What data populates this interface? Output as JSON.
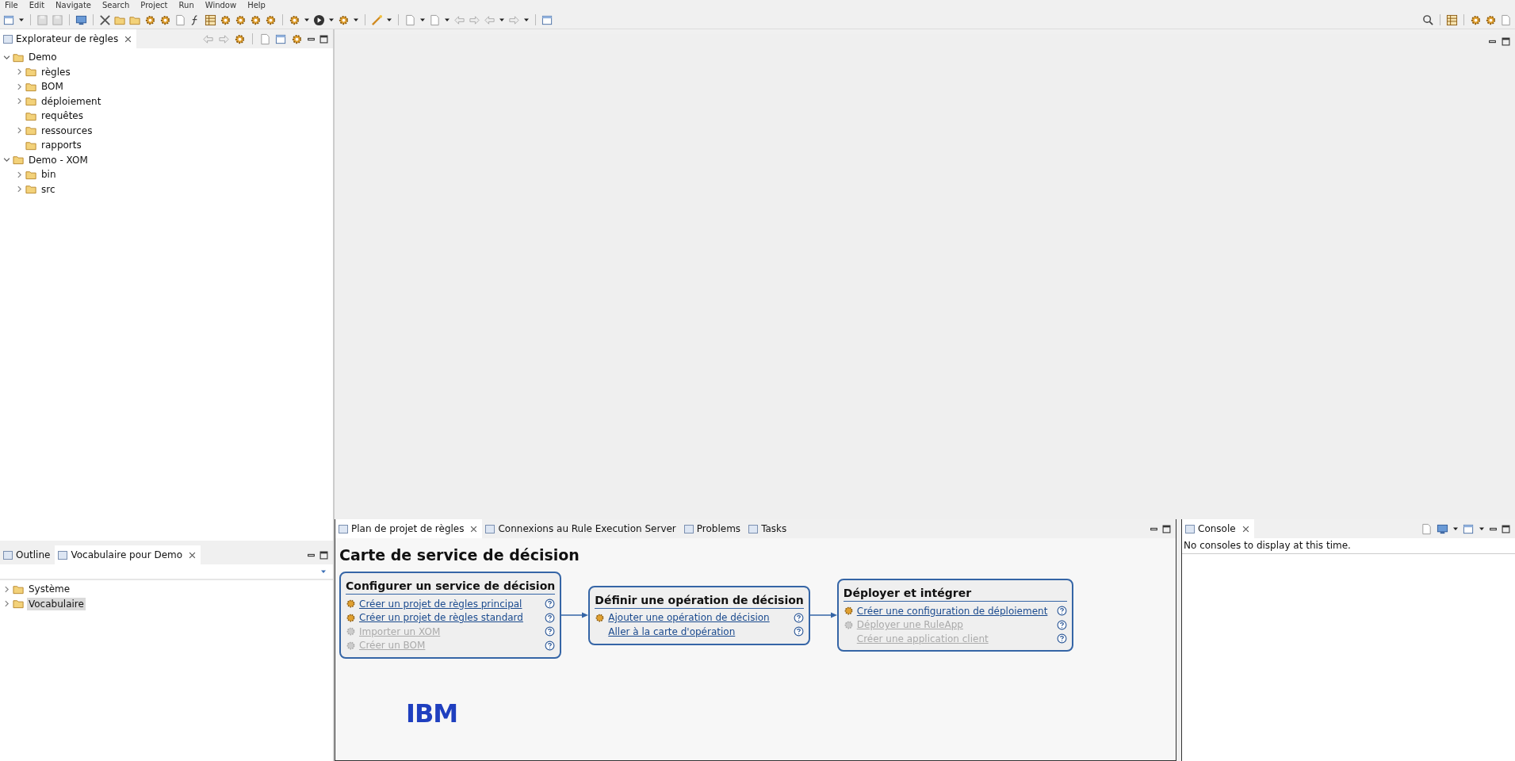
{
  "menu": [
    "File",
    "Edit",
    "Navigate",
    "Search",
    "Project",
    "Run",
    "Window",
    "Help"
  ],
  "explorer": {
    "tabs": [
      {
        "label": "Explorateur de règles",
        "selected": true
      }
    ],
    "tree": [
      {
        "label": "Demo",
        "kind": "expanded",
        "selected": false,
        "children": [
          {
            "label": "règles",
            "kind": "collapsed",
            "selected": false
          },
          {
            "label": "BOM",
            "kind": "collapsed",
            "selected": false
          },
          {
            "label": "déploiement",
            "kind": "collapsed",
            "selected": false
          },
          {
            "label": "requêtes",
            "kind": "leaf",
            "selected": false
          },
          {
            "label": "ressources",
            "kind": "collapsed",
            "selected": false
          },
          {
            "label": "rapports",
            "kind": "leaf",
            "selected": false
          }
        ]
      },
      {
        "label": "Demo - XOM",
        "kind": "expanded",
        "selected": false,
        "children": [
          {
            "label": "bin",
            "kind": "collapsed",
            "selected": false
          },
          {
            "label": "src",
            "kind": "collapsed",
            "selected": false
          }
        ]
      }
    ]
  },
  "vocabulary": {
    "tabs": [
      {
        "label": "Outline",
        "selected": false
      },
      {
        "label": "Vocabulaire pour Demo",
        "selected": true
      }
    ],
    "tree": [
      {
        "label": "Système",
        "kind": "collapsed",
        "selected": false
      },
      {
        "label": "Vocabulaire",
        "kind": "collapsed",
        "selected": true
      }
    ]
  },
  "plan": {
    "tabs": [
      {
        "label": "Plan de projet de règles",
        "selected": true
      },
      {
        "label": "Connexions au Rule Execution Server",
        "selected": false
      },
      {
        "label": "Problems",
        "selected": false
      },
      {
        "label": "Tasks",
        "selected": false
      }
    ],
    "title": "Carte de service de décision",
    "steps": [
      {
        "title": "Configurer un service de décision",
        "links": [
          {
            "label": "Créer un projet de règles principal",
            "enabled": true,
            "has_icon": true
          },
          {
            "label": "Créer un projet de règles standard",
            "enabled": true,
            "has_icon": true
          },
          {
            "label": "Importer un XOM",
            "enabled": false,
            "has_icon": true
          },
          {
            "label": "Créer un BOM",
            "enabled": false,
            "has_icon": true
          }
        ]
      },
      {
        "title": "Définir une opération de décision",
        "links": [
          {
            "label": "Ajouter une opération de décision",
            "enabled": true,
            "has_icon": true
          },
          {
            "label": "Aller à la carte d'opération",
            "enabled": true,
            "has_icon": false
          }
        ]
      },
      {
        "title": "Déployer et intégrer",
        "links": [
          {
            "label": "Créer une configuration de déploiement",
            "enabled": true,
            "has_icon": true
          },
          {
            "label": "Déployer une RuleApp",
            "enabled": false,
            "has_icon": true
          },
          {
            "label": "Créer une application client",
            "enabled": false,
            "has_icon": false
          }
        ]
      }
    ],
    "logo": "IBM"
  },
  "console": {
    "tabs": [
      {
        "label": "Console",
        "selected": true
      }
    ],
    "message": "No consoles to display at this time."
  }
}
